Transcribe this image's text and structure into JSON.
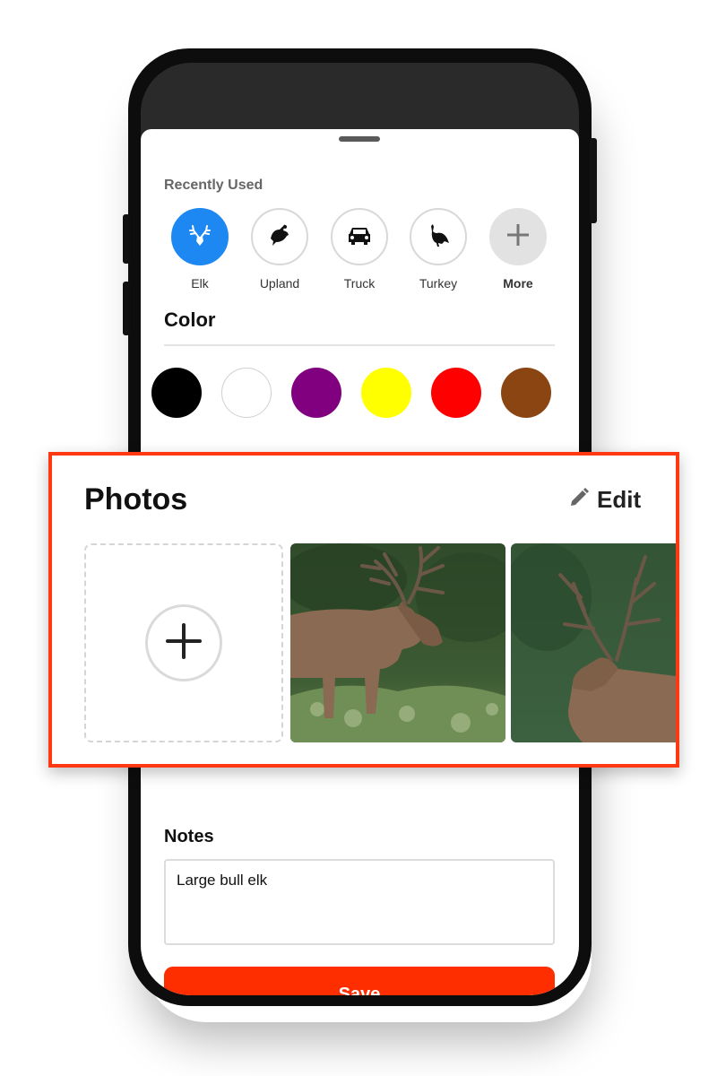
{
  "recently_used": {
    "title": "Recently Used",
    "items": [
      {
        "label": "Elk",
        "icon": "elk-icon",
        "active": true
      },
      {
        "label": "Upland",
        "icon": "upland-bird-icon"
      },
      {
        "label": "Truck",
        "icon": "truck-icon"
      },
      {
        "label": "Turkey",
        "icon": "turkey-icon"
      },
      {
        "label": "More",
        "icon": "plus-icon"
      }
    ]
  },
  "color_section": {
    "title": "Color",
    "swatches": [
      "#000000",
      "#ffffff",
      "#800080",
      "#ffff00",
      "#ff0000",
      "#8b4513"
    ]
  },
  "photos": {
    "title": "Photos",
    "edit_label": "Edit"
  },
  "notes": {
    "title": "Notes",
    "value": "Large bull elk"
  },
  "save_label": "Save",
  "colors": {
    "accent": "#ff2e00",
    "active_icon": "#1e88f2",
    "highlight_border": "#ff3a12"
  }
}
